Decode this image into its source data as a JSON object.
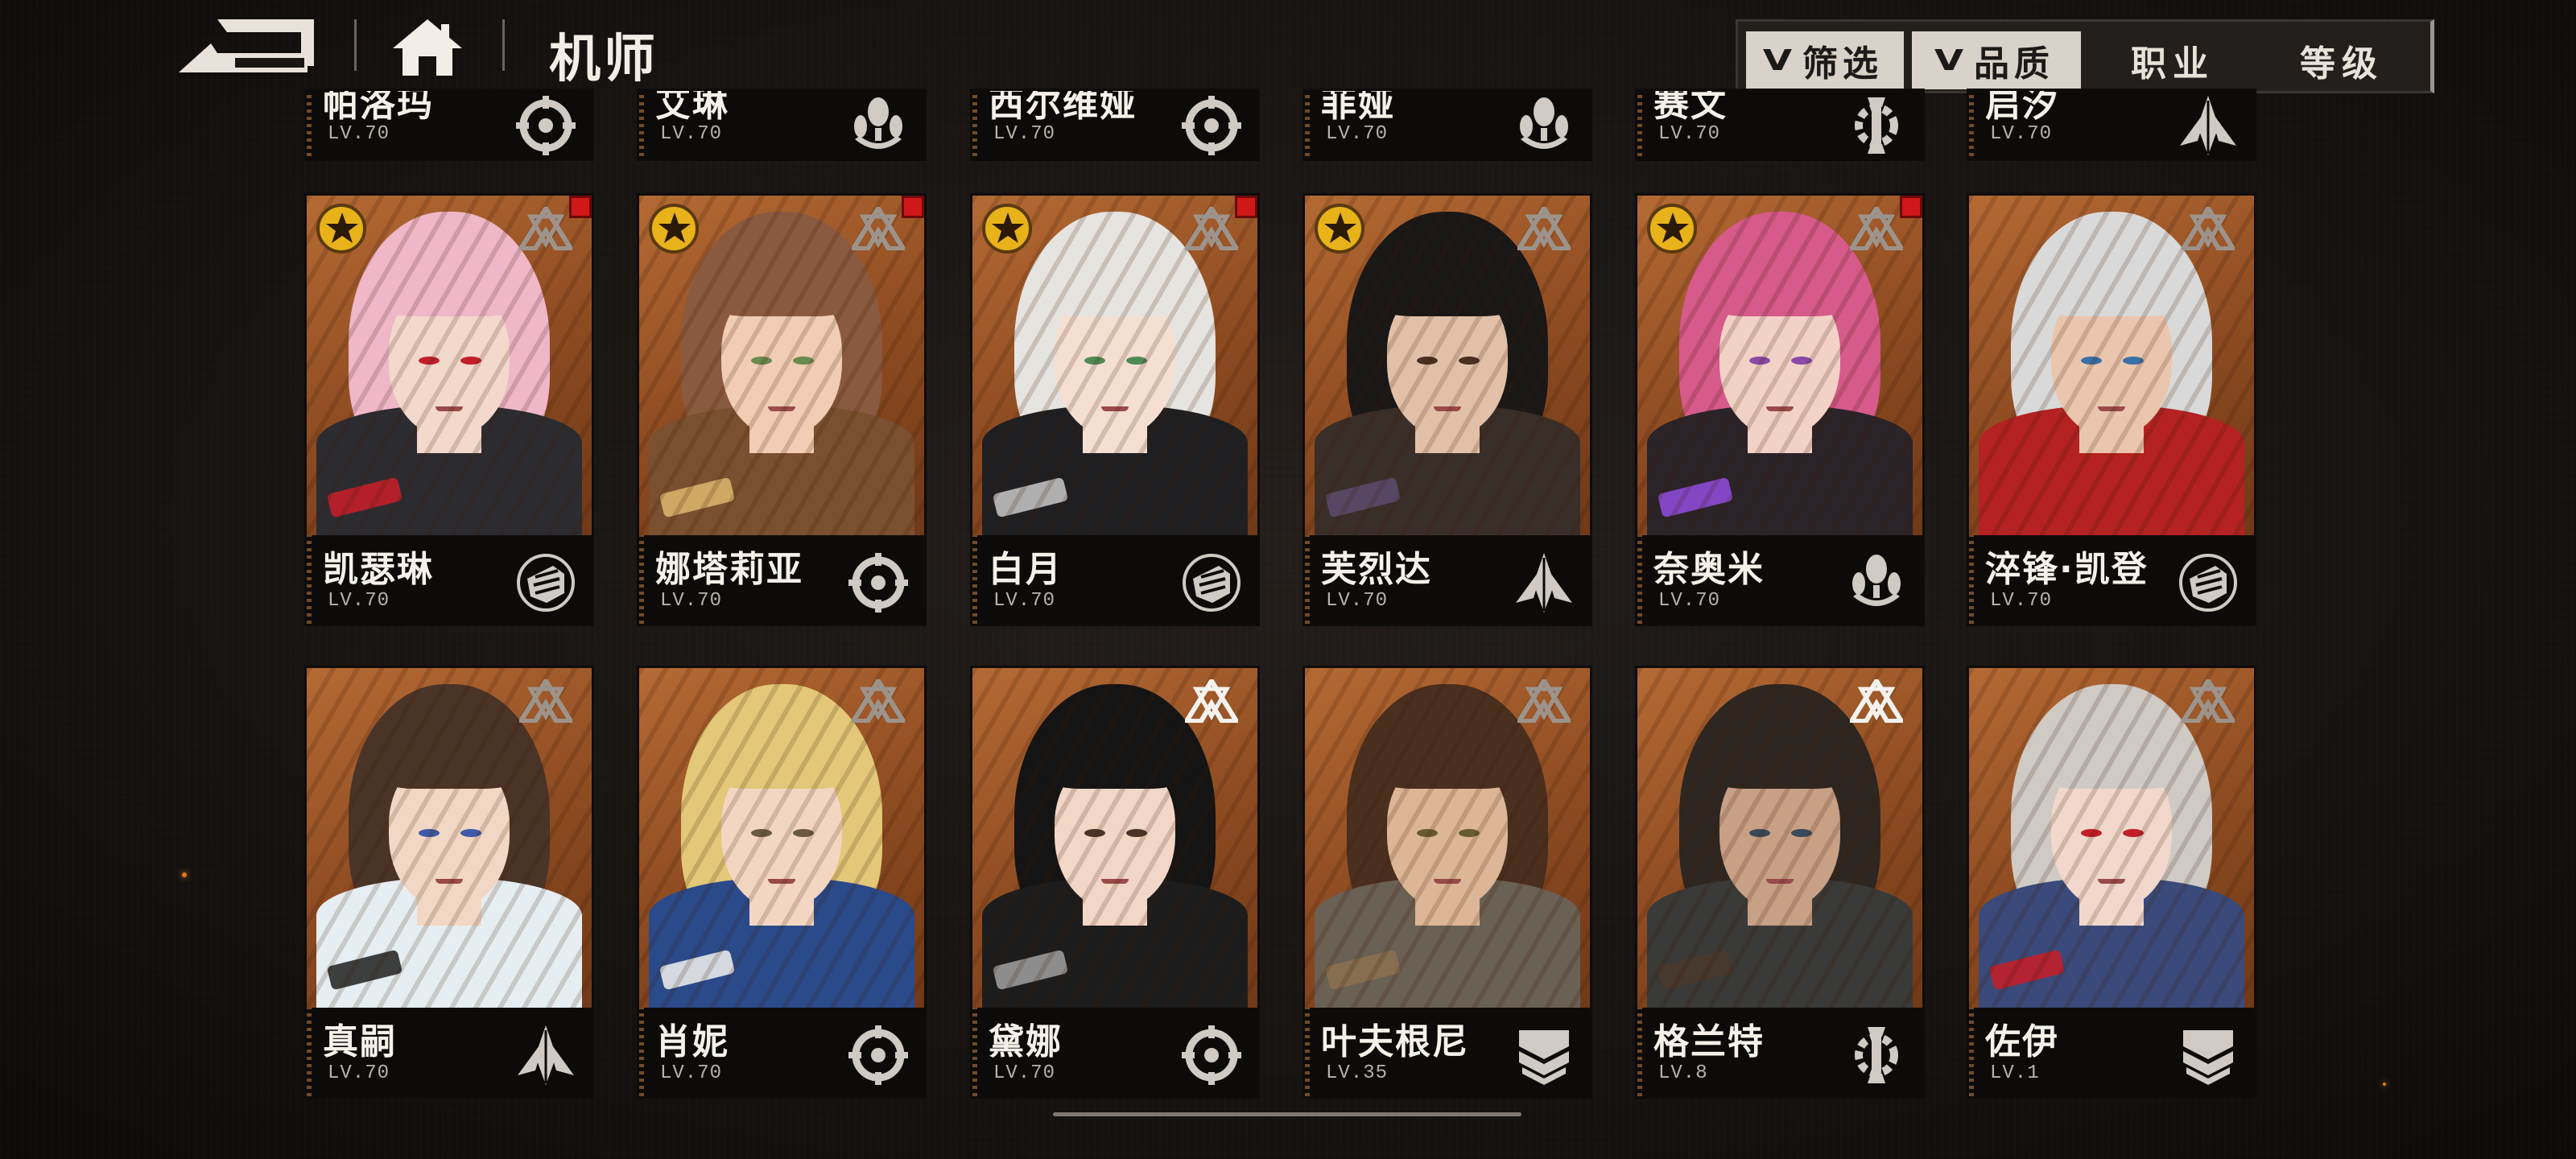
{
  "header": {
    "title": "机师",
    "filters": [
      {
        "label": "筛选",
        "active": true
      },
      {
        "label": "品质",
        "active": true
      },
      {
        "label": "职业",
        "active": false
      },
      {
        "label": "等级",
        "active": false
      }
    ]
  },
  "pilots": [
    {
      "name": "帕洛玛",
      "level": "LV.70",
      "class_icon": "target-icon",
      "rank": "silver",
      "starred": false,
      "is_new": false,
      "palette": {
        "hair": "#3a2a22",
        "skin": "#e8c8b0",
        "body": "#333"
      }
    },
    {
      "name": "艾琳",
      "level": "LV.70",
      "class_icon": "bomb-icon",
      "rank": "silver",
      "starred": false,
      "is_new": false,
      "palette": {
        "hair": "#5a3a2a",
        "skin": "#e8c8b0",
        "body": "#333"
      }
    },
    {
      "name": "西尔维娅",
      "level": "LV.70",
      "class_icon": "target-icon",
      "rank": "silver",
      "starred": false,
      "is_new": false,
      "palette": {
        "hair": "#ddd",
        "skin": "#e8c8b0",
        "body": "#333"
      }
    },
    {
      "name": "菲娅",
      "level": "LV.70",
      "class_icon": "bomb-icon",
      "rank": "silver",
      "starred": false,
      "is_new": false,
      "palette": {
        "hair": "#222",
        "skin": "#e8c8b0",
        "body": "#333"
      }
    },
    {
      "name": "赛文",
      "level": "LV.70",
      "class_icon": "wrench-gear-icon",
      "rank": "silver",
      "starred": false,
      "is_new": false,
      "palette": {
        "hair": "#444",
        "skin": "#e8c8b0",
        "body": "#333"
      }
    },
    {
      "name": "启汐",
      "level": "LV.70",
      "class_icon": "blade-icon",
      "rank": "silver",
      "starred": false,
      "is_new": false,
      "palette": {
        "hair": "#666",
        "skin": "#e8c8b0",
        "body": "#333"
      }
    },
    {
      "name": "凯瑟琳",
      "level": "LV.70",
      "class_icon": "fist-icon",
      "rank": "silver",
      "starred": true,
      "is_new": true,
      "palette": {
        "hair": "#efb7c8",
        "skin": "#f3d8cc",
        "body": "#2c2c30",
        "eye": "#c21f2a",
        "accent": "#c21f2a"
      }
    },
    {
      "name": "娜塔莉亚",
      "level": "LV.70",
      "class_icon": "target-icon",
      "rank": "silver",
      "starred": true,
      "is_new": true,
      "palette": {
        "hair": "#8a5a40",
        "skin": "#f0cdb4",
        "body": "#7a5030",
        "eye": "#6a8a50",
        "accent": "#d9b06a"
      }
    },
    {
      "name": "白月",
      "level": "LV.70",
      "class_icon": "fist-icon",
      "rank": "silver",
      "starred": true,
      "is_new": true,
      "palette": {
        "hair": "#e6e4e0",
        "skin": "#f4dfd2",
        "body": "#1f1f22",
        "eye": "#4f8a56",
        "accent": "#bfbfbf"
      }
    },
    {
      "name": "芙烈达",
      "level": "LV.70",
      "class_icon": "blade-icon",
      "rank": "silver",
      "starred": true,
      "is_new": false,
      "palette": {
        "hair": "#1a1817",
        "skin": "#e2c0a8",
        "body": "#3a2e28",
        "eye": "#4a3020",
        "accent": "#5a4a6a"
      }
    },
    {
      "name": "奈奥米",
      "level": "LV.70",
      "class_icon": "bomb-icon",
      "rank": "silver",
      "starred": true,
      "is_new": true,
      "palette": {
        "hair": "#d65a8a",
        "skin": "#f2d2c6",
        "body": "#2a2328",
        "eye": "#8a4aa8",
        "accent": "#8d4ad6"
      }
    },
    {
      "name": "淬锋·凯登",
      "level": "LV.70",
      "class_icon": "fist-icon",
      "rank": "silver",
      "starred": false,
      "is_new": false,
      "palette": {
        "hair": "#d9d9d9",
        "skin": "#ebc6ae",
        "body": "#b42222",
        "eye": "#3a70a8",
        "accent": "#b42222"
      }
    },
    {
      "name": "真嗣",
      "level": "LV.70",
      "class_icon": "blade-icon",
      "rank": "silver",
      "starred": false,
      "is_new": false,
      "palette": {
        "hair": "#4a3428",
        "skin": "#f2d8c4",
        "body": "#e6eef2",
        "eye": "#3e5aa8",
        "accent": "#2a2a2a"
      }
    },
    {
      "name": "肖妮",
      "level": "LV.70",
      "class_icon": "target-icon",
      "rank": "silver",
      "starred": false,
      "is_new": false,
      "palette": {
        "hair": "#e2c878",
        "skin": "#f3d6c2",
        "body": "#2a4a8a",
        "eye": "#6a5a40",
        "accent": "#e8e8e8"
      }
    },
    {
      "name": "黛娜",
      "level": "LV.70",
      "class_icon": "target-icon",
      "rank": "white",
      "starred": false,
      "is_new": false,
      "palette": {
        "hair": "#141414",
        "skin": "#f2d6c6",
        "body": "#1c1c1c",
        "eye": "#4a3428",
        "accent": "#9a9a9a"
      }
    },
    {
      "name": "叶夫根尼",
      "level": "LV.35",
      "class_icon": "shield-icon",
      "rank": "silver",
      "starred": false,
      "is_new": false,
      "palette": {
        "hair": "#4a2e1e",
        "skin": "#dcb696",
        "body": "#6a6054",
        "eye": "#6a5a30",
        "accent": "#8a7050"
      }
    },
    {
      "name": "格兰特",
      "level": "LV.8",
      "class_icon": "wrench-gear-icon",
      "rank": "white",
      "starred": false,
      "is_new": false,
      "palette": {
        "hair": "#2e2620",
        "skin": "#c8a086",
        "body": "#3a3a38",
        "eye": "#3a4a5a",
        "accent": "#4a3a2e"
      }
    },
    {
      "name": "佐伊",
      "level": "LV.1",
      "class_icon": "shield-icon",
      "rank": "silver",
      "starred": false,
      "is_new": false,
      "palette": {
        "hair": "#cfcac4",
        "skin": "#f2d8cc",
        "body": "#3a4a7a",
        "eye": "#c21f2a",
        "accent": "#c21f2a"
      }
    }
  ]
}
